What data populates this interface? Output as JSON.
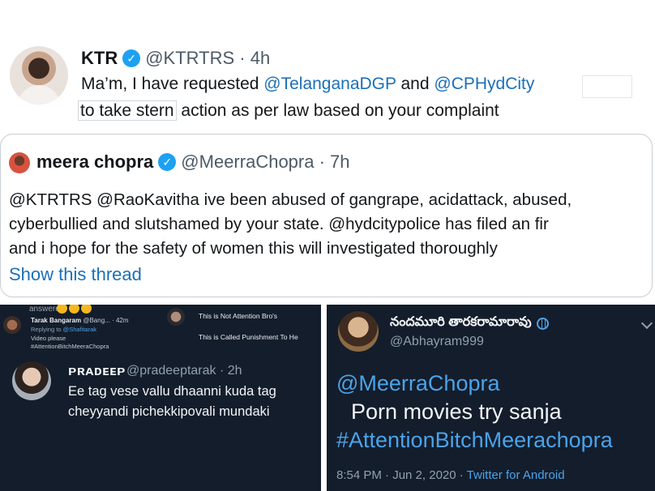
{
  "ktr_tweet": {
    "name": "KTR",
    "handle": "@KTRTRS",
    "time": "4h",
    "text_prefix": "Ma’m, I have requested ",
    "mention1": "@TelanganaDGP",
    "and_word": " and ",
    "mention2": "@CPHydCity",
    "line2_boxed": "to take stern",
    "line2_rest": " action as per law based on your complaint"
  },
  "meera_tweet": {
    "name": "meera chopra",
    "handle": "@MeerraChopra",
    "time": "7h",
    "lines": [
      "@KTRTRS @RaoKavitha ive been abused of gangrape, acidattack, abused,",
      "cyberbullied and slutshamed by your state. @hydcitypolice has filed an fir",
      "and i hope for the safety of women this will investigated thoroughly"
    ],
    "show_thread": "Show this thread"
  },
  "left_screenshot": {
    "scribble": "answered",
    "reply_author": "Tarak Bangaram",
    "reply_handle": "@Bang...",
    "reply_time": "42m",
    "replying_prefix": "Replying to",
    "replying_to": "@Shafitarak",
    "line1": "Video please",
    "line2": "#AttentionBitchMeeraChopra",
    "side_text1": "This is Not Attention Bro's",
    "side_text2": "This is Called Punishment To He",
    "main_author": "ᴘʀᴀᴅᴇᴇᴘ",
    "main_handle": "@pradeeptarak · 2h",
    "main_lines": [
      "Ee tag vese vallu dhaanni kuda tag",
      "cheyyandi pichekkipovali mundaki"
    ]
  },
  "right_screenshot": {
    "name": "నందమూరి తారకరామారావు",
    "handle": "@Abhayram999",
    "mention": "@MeerraChopra",
    "text": "Porn movies try sanja",
    "hashtag": "#AttentionBitchMeerachopra",
    "timestamp": "8:54 PM · Jun 2, 2020 · ",
    "source": "Twitter for Android"
  },
  "icons": {
    "verified": "verified-badge-icon",
    "globe": "globe-icon",
    "chevron": "chevron-down-icon"
  },
  "colors": {
    "link": "#1b6fb8",
    "verified": "#1da1f2",
    "dark_bg": "#141d2b",
    "dark_link": "#4aa3ea"
  }
}
